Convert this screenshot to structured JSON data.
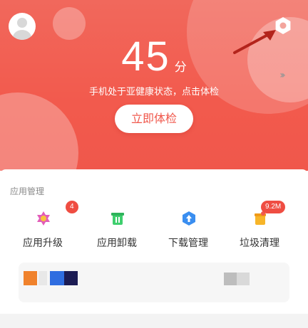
{
  "hero": {
    "score": "45",
    "score_unit": "分",
    "status": "手机处于亚健康状态，点击体检",
    "check_button": "立即体检"
  },
  "colors": {
    "accent": "#f0574b",
    "badge": "#ef4d42"
  },
  "section": {
    "title": "应用管理"
  },
  "tools": [
    {
      "label": "应用升级",
      "icon": "upgrade-icon",
      "badge": "4"
    },
    {
      "label": "应用卸载",
      "icon": "uninstall-icon",
      "badge": ""
    },
    {
      "label": "下载管理",
      "icon": "download-icon",
      "badge": ""
    },
    {
      "label": "垃圾清理",
      "icon": "trash-clean-icon",
      "badge": "9.2M"
    }
  ]
}
